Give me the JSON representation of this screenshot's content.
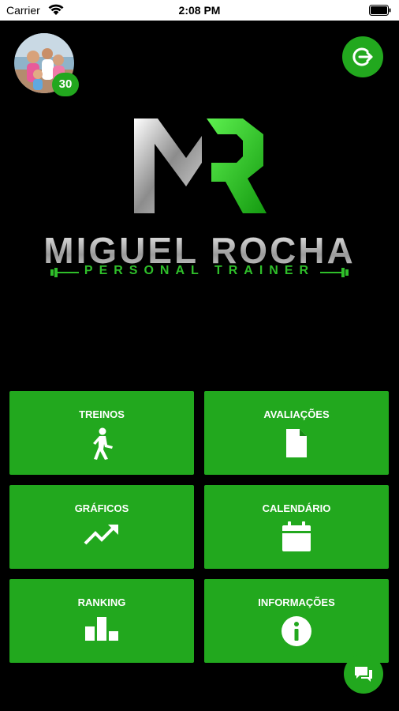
{
  "status_bar": {
    "carrier": "Carrier",
    "time": "2:08 PM"
  },
  "profile": {
    "badge_count": "30"
  },
  "brand": {
    "name": "MIGUEL ROCHA",
    "tagline": "PERSONAL TRAINER",
    "accent_color": "#22a81e"
  },
  "menu": {
    "treinos": "TREINOS",
    "avaliacoes": "AVALIAÇÕES",
    "graficos": "GRÁFICOS",
    "calendario": "CALENDÁRIO",
    "ranking": "RANKING",
    "informacoes": "INFORMAÇÕES"
  },
  "icons": {
    "treinos": "walking-person-icon",
    "avaliacoes": "document-icon",
    "graficos": "trending-up-icon",
    "calendario": "calendar-icon",
    "ranking": "podium-icon",
    "informacoes": "info-icon",
    "logout": "logout-icon",
    "chat": "chat-icon"
  }
}
